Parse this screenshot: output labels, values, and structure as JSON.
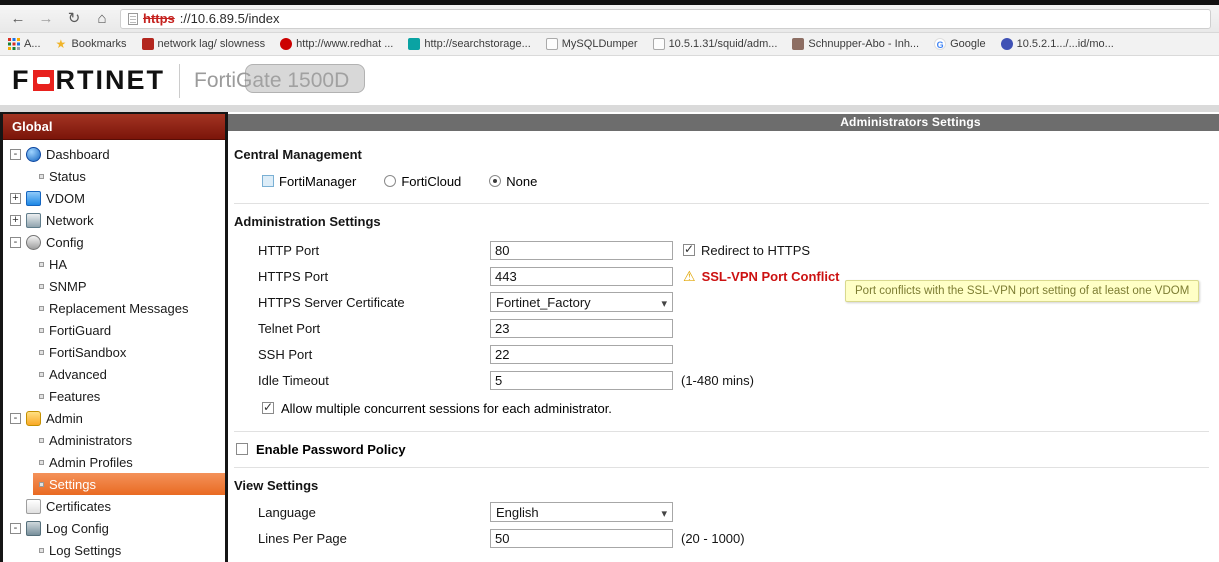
{
  "colors": {
    "sidebar_header_red": "#8c1a0e",
    "selected_orange": "#ed7330",
    "titlebar_gray": "#6d6d6d",
    "conflict_red": "#cc1111",
    "tooltip_bg": "#ffffc6"
  },
  "browser": {
    "address": {
      "scheme": "https",
      "rest": "://10.6.89.5/index"
    },
    "bookmarks": [
      {
        "label": "A..."
      },
      {
        "label": "Bookmarks"
      },
      {
        "label": "network lag/ slowness"
      },
      {
        "label": "http://www.redhat ..."
      },
      {
        "label": "http://searchstorage..."
      },
      {
        "label": "MySQLDumper"
      },
      {
        "label": "10.5.1.31/squid/adm..."
      },
      {
        "label": "Schnupper-Abo - Inh..."
      },
      {
        "label": "Google"
      },
      {
        "label": "10.5.2.1.../...id/mo..."
      }
    ]
  },
  "app": {
    "brand_prefix": "F",
    "brand_suffix": "RTINET",
    "device_name": "FortiGate 1500D"
  },
  "sidebar": {
    "header": "Global",
    "items": [
      {
        "label": "Dashboard",
        "toggle": "-"
      },
      {
        "label": "Status"
      },
      {
        "label": "VDOM",
        "toggle": "+"
      },
      {
        "label": "Network",
        "toggle": "+"
      },
      {
        "label": "Config",
        "toggle": "-"
      },
      {
        "label": "HA"
      },
      {
        "label": "SNMP"
      },
      {
        "label": "Replacement Messages"
      },
      {
        "label": "FortiGuard"
      },
      {
        "label": "FortiSandbox"
      },
      {
        "label": "Advanced"
      },
      {
        "label": "Features"
      },
      {
        "label": "Admin",
        "toggle": "-"
      },
      {
        "label": "Administrators"
      },
      {
        "label": "Admin Profiles"
      },
      {
        "label": "Settings",
        "selected": true
      },
      {
        "label": "Certificates"
      },
      {
        "label": "Log Config",
        "toggle": "-"
      },
      {
        "label": "Log Settings"
      }
    ]
  },
  "main": {
    "title": "Administrators Settings",
    "central_management": {
      "heading": "Central Management",
      "options": [
        {
          "label": "FortiManager",
          "selected": false
        },
        {
          "label": "FortiCloud",
          "selected": false
        },
        {
          "label": "None",
          "selected": true
        }
      ]
    },
    "administration": {
      "heading": "Administration Settings",
      "http_port": {
        "label": "HTTP Port",
        "value": "80"
      },
      "redirect_https": {
        "label": "Redirect to HTTPS",
        "checked": true
      },
      "https_port": {
        "label": "HTTPS Port",
        "value": "443"
      },
      "conflict_warning": "SSL-VPN Port Conflict",
      "conflict_tooltip": "Port conflicts with the SSL-VPN port setting of at least one VDOM",
      "https_cert": {
        "label": "HTTPS Server Certificate",
        "value": "Fortinet_Factory"
      },
      "telnet_port": {
        "label": "Telnet Port",
        "value": "23"
      },
      "ssh_port": {
        "label": "SSH Port",
        "value": "22"
      },
      "idle_timeout": {
        "label": "Idle Timeout",
        "value": "5",
        "hint": "(1-480 mins)"
      },
      "concurrent": {
        "label": "Allow multiple concurrent sessions for each administrator.",
        "checked": true
      }
    },
    "password_policy": {
      "label": "Enable Password Policy",
      "checked": false
    },
    "view_settings": {
      "heading": "View Settings",
      "language": {
        "label": "Language",
        "value": "English"
      },
      "lines_per_page": {
        "label": "Lines Per Page",
        "value": "50",
        "hint": "(20 - 1000)"
      }
    }
  }
}
